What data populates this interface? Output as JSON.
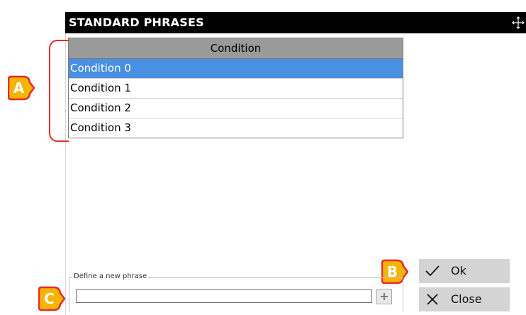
{
  "dialog": {
    "title": "STANDARD PHRASES"
  },
  "grid": {
    "column_header": "Condition",
    "rows": [
      "Condition 0",
      "Condition 1",
      "Condition 2",
      "Condition 3"
    ],
    "selected_index": 0
  },
  "phrase_box": {
    "legend": "Define a new phrase",
    "value": "",
    "add_symbol": "+"
  },
  "buttons": {
    "ok_label": "Ok",
    "close_label": "Close"
  },
  "markers": {
    "a": "A",
    "b": "B",
    "c": "C"
  },
  "colors": {
    "titlebar": "#000000",
    "selection": "#4a90e2",
    "header": "#9a9a9a",
    "annotation": "#e52b2b",
    "marker_fill": "#f4b400",
    "button_bg": "#d4d4d4"
  },
  "icons": {
    "move": "move-arrows-icon",
    "ok": "checkmark-icon",
    "close": "close-icon",
    "add": "plus-icon"
  }
}
